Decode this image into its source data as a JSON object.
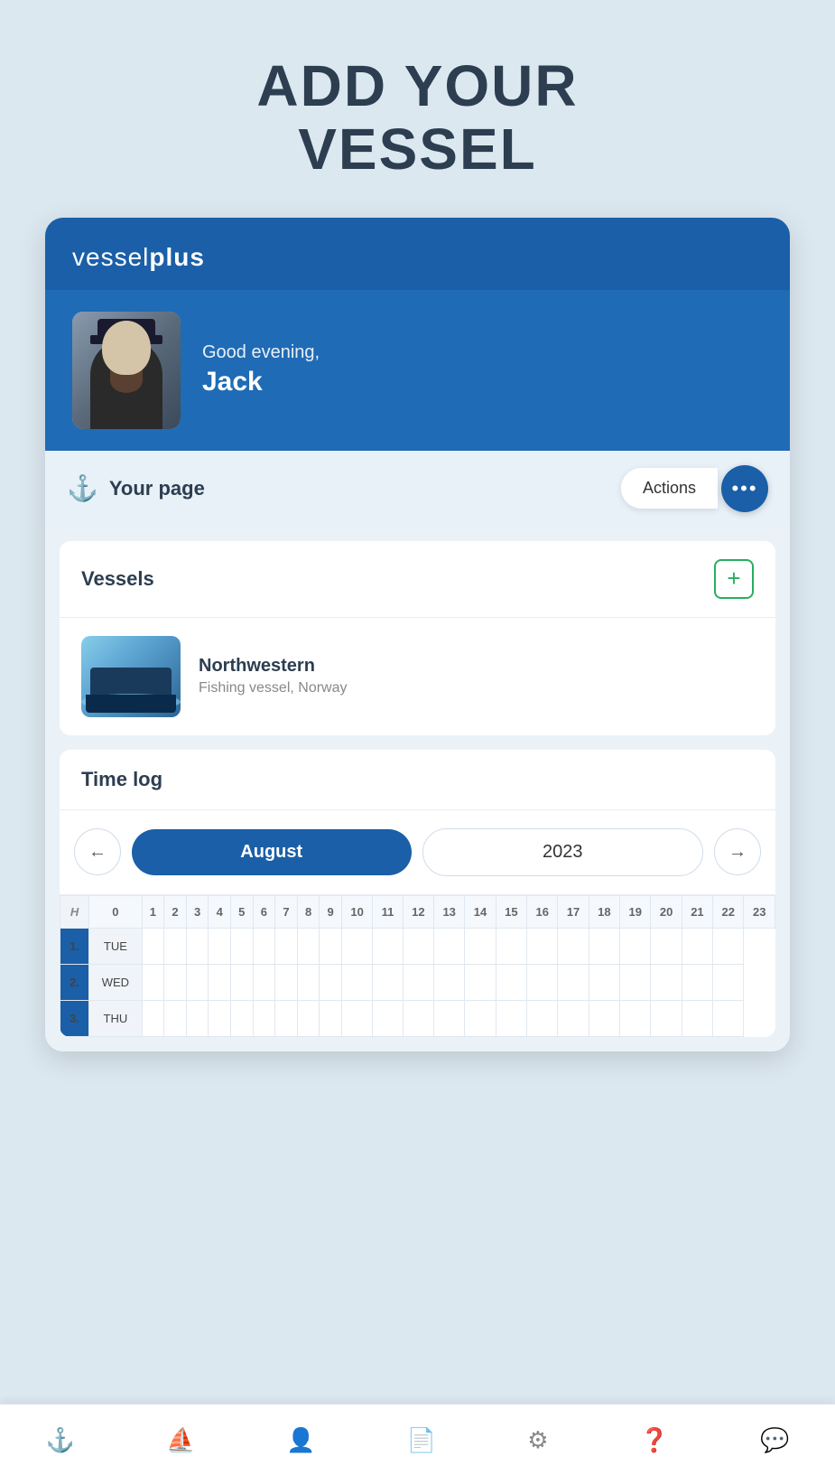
{
  "page": {
    "title_line1": "ADD YOUR",
    "title_line2": "VESSEL"
  },
  "app": {
    "logo_light": "vessel",
    "logo_bold": "plus"
  },
  "greeting": {
    "sub": "Good evening,",
    "name": "Jack"
  },
  "your_page": {
    "label": "Your page",
    "actions_label": "Actions"
  },
  "vessels": {
    "section_title": "Vessels",
    "items": [
      {
        "name": "Northwestern",
        "description": "Fishing vessel, Norway"
      }
    ]
  },
  "timelog": {
    "section_title": "Time log",
    "month": "August",
    "year": "2023",
    "columns": [
      "H",
      "0",
      "1",
      "2",
      "3",
      "4",
      "5",
      "6",
      "7",
      "8",
      "9",
      "10",
      "11",
      "12",
      "13",
      "14",
      "15",
      "16",
      "17",
      "18",
      "19",
      "20",
      "21",
      "22",
      "23"
    ],
    "rows": [
      {
        "num": "1.",
        "day": "TUE"
      },
      {
        "num": "2.",
        "day": "WED"
      },
      {
        "num": "3.",
        "day": "THU"
      }
    ]
  },
  "bottom_nav": {
    "items": [
      {
        "icon": "⚓",
        "label": ""
      },
      {
        "icon": "⛵",
        "label": ""
      },
      {
        "icon": "👤",
        "label": ""
      },
      {
        "icon": "📄",
        "label": ""
      },
      {
        "icon": "⚙",
        "label": ""
      },
      {
        "icon": "❓",
        "label": ""
      },
      {
        "icon": "💬",
        "label": ""
      }
    ]
  }
}
